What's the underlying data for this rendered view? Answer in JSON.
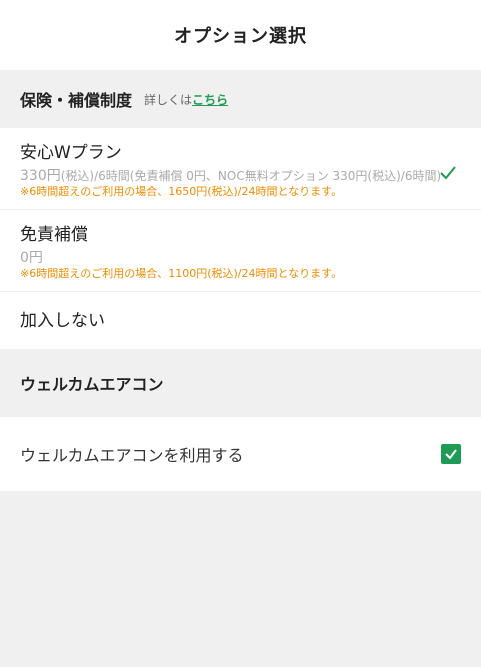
{
  "header": {
    "title": "オプション選択"
  },
  "insurance": {
    "title": "保険・補償制度",
    "note": "詳しくは",
    "link": "こちら",
    "options": [
      {
        "title": "安心Wプラン",
        "price": "330円",
        "detail": "(税込)/6時間(免責補償 0円、NOC無料オプション 330円(税込)/6時間)",
        "note": "※6時間超えのご利用の場合、1650円(税込)/24時間となります。",
        "selected": true
      },
      {
        "title": "免責補償",
        "price": "0円",
        "note": "※6時間超えのご利用の場合、1100円(税込)/24時間となります。",
        "selected": false
      },
      {
        "title": "加入しない",
        "selected": false
      }
    ]
  },
  "welcome": {
    "title": "ウェルカムエアコン",
    "option_label": "ウェルカムエアコンを利用する",
    "checked": true
  },
  "colors": {
    "accent": "#1e9b54",
    "warning": "#f08c00"
  },
  "icons": {
    "selected": "checkmark-icon",
    "checkbox": "checkbox-checked-icon"
  }
}
